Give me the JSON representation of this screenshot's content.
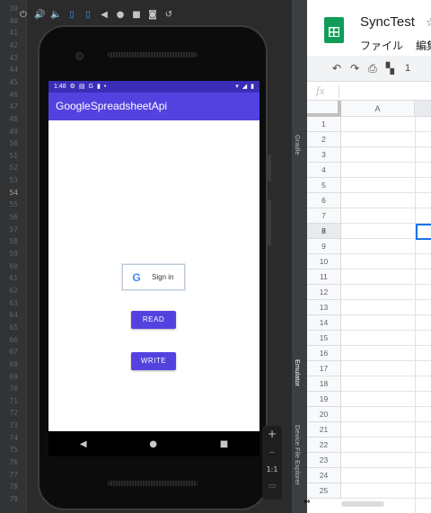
{
  "ide": {
    "line_numbers": [
      "39",
      "40",
      "41",
      "42",
      "43",
      "44",
      "45",
      "46",
      "47",
      "48",
      "49",
      "50",
      "51",
      "52",
      "53",
      "54",
      "55",
      "56",
      "57",
      "58",
      "59",
      "60",
      "61",
      "62",
      "63",
      "64",
      "65",
      "66",
      "67",
      "68",
      "69",
      "70",
      "71",
      "72",
      "73",
      "74",
      "75",
      "76",
      "77",
      "78",
      "79"
    ],
    "current_line": "54"
  },
  "emulator": {
    "toolbar_icons": [
      "power-icon",
      "volume-up-icon",
      "volume-down-icon",
      "rotate-left-icon",
      "rotate-right-icon",
      "back-icon",
      "home-icon",
      "overview-icon",
      "camera-icon",
      "snapshot-icon"
    ],
    "zoom_in": "+",
    "zoom_out": "–",
    "zoom_ratio": "1:1"
  },
  "phone": {
    "status": {
      "time": "1:48",
      "extra_icons": [
        "settings-icon",
        "card-icon",
        "G",
        "clipboard-icon",
        "•"
      ]
    },
    "app_title": "GoogleSpreadsheetApi",
    "signin_label": "Sign in",
    "read_label": "READ",
    "write_label": "WRITE",
    "nav": [
      "back-icon",
      "home-icon",
      "recents-icon"
    ]
  },
  "tool_windows": {
    "gradle": "Gradle",
    "emulator": "Emulator",
    "device_file_explorer": "Device File Explorer"
  },
  "sheets": {
    "title": "SyncTest",
    "menu": [
      "ファイル",
      "編集"
    ],
    "toolbar_number": "1",
    "fx": "fx",
    "column": "A",
    "rows": [
      "1",
      "2",
      "3",
      "4",
      "5",
      "6",
      "7",
      "8",
      "9",
      "10",
      "11",
      "12",
      "13",
      "14",
      "15",
      "16",
      "17",
      "18",
      "19",
      "20",
      "21",
      "22",
      "23",
      "24",
      "25"
    ],
    "selected_row": "8",
    "colors": {
      "green": "#0f9d58",
      "blue": "#1a73e8"
    }
  },
  "colors": {
    "appbar": "#5442e0",
    "statusbar": "#3b2db7",
    "ide_bg": "#2b2b2b"
  }
}
